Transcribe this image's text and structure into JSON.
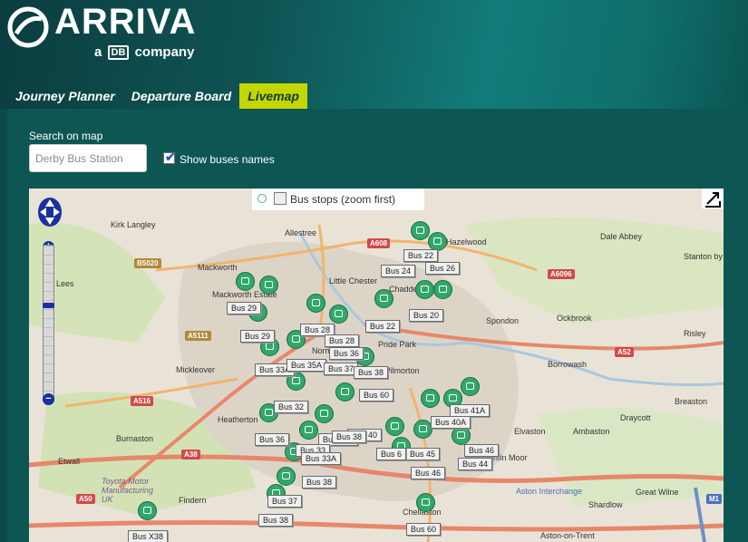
{
  "brand": {
    "name": "ARRIVA",
    "tagline_pre": "a",
    "tagline_db": "DB",
    "tagline_post": "company"
  },
  "nav": {
    "tabs": [
      {
        "label": "Journey Planner",
        "active": false
      },
      {
        "label": "Departure Board",
        "active": false
      },
      {
        "label": "Livemap",
        "active": true
      }
    ]
  },
  "search": {
    "label": "Search on map",
    "value": "Derby Bus Station"
  },
  "show_names": {
    "label": "Show buses names",
    "checked": true
  },
  "map": {
    "bus_stops_label": "Bus stops (zoom first)",
    "zoom_in": "+",
    "zoom_out": "−",
    "places": [
      "Kirk Langley",
      "Allestree",
      "Dale Abbey",
      "Stanton by",
      "Mackworth",
      "Mackworth Estate",
      "Little Chester",
      "Spondon",
      "Ockbrook",
      "Pride Park",
      "Risley",
      "Mickleover",
      "Wilmorton",
      "Borrowash",
      "Breaston",
      "Heatherton",
      "Draycott",
      "Burnaston",
      "Elvaston",
      "Ambaston",
      "Etwall",
      "Toyota Motor Manufacturing UK",
      "Findern",
      "Sinfin Moor",
      "Aston Interchange",
      "Shardlow",
      "Great Wilne",
      "Chellaston",
      "Aston-on-Trent",
      "Normanton",
      "Lees",
      "Hazelwood",
      "Chaddesden"
    ],
    "roads": [
      "B5020",
      "A608",
      "A6096",
      "A52",
      "A516",
      "A38",
      "A50",
      "M1",
      "A5111"
    ],
    "bus_labels": [
      "Bus 22",
      "Bus 24",
      "Bus 26",
      "Bus 29",
      "Bus 20",
      "Bus 28",
      "Bus 22",
      "Bus 29",
      "Bus 28",
      "Bus 36",
      "Bus 33A",
      "Bus 35A",
      "Bus 37",
      "Bus 38",
      "Bus 60",
      "Bus 41A",
      "Bus 40A",
      "Bus 32",
      "Bus 36",
      "Bus 36A",
      "Bus 40",
      "Bus 38",
      "Bus 33",
      "Bus 33A",
      "Bus 45",
      "Bus 46",
      "Bus 6",
      "Bus 44",
      "Bus 46",
      "Bus 38",
      "Bus 37",
      "Bus 38",
      "Bus 60",
      "Bus X38"
    ]
  }
}
